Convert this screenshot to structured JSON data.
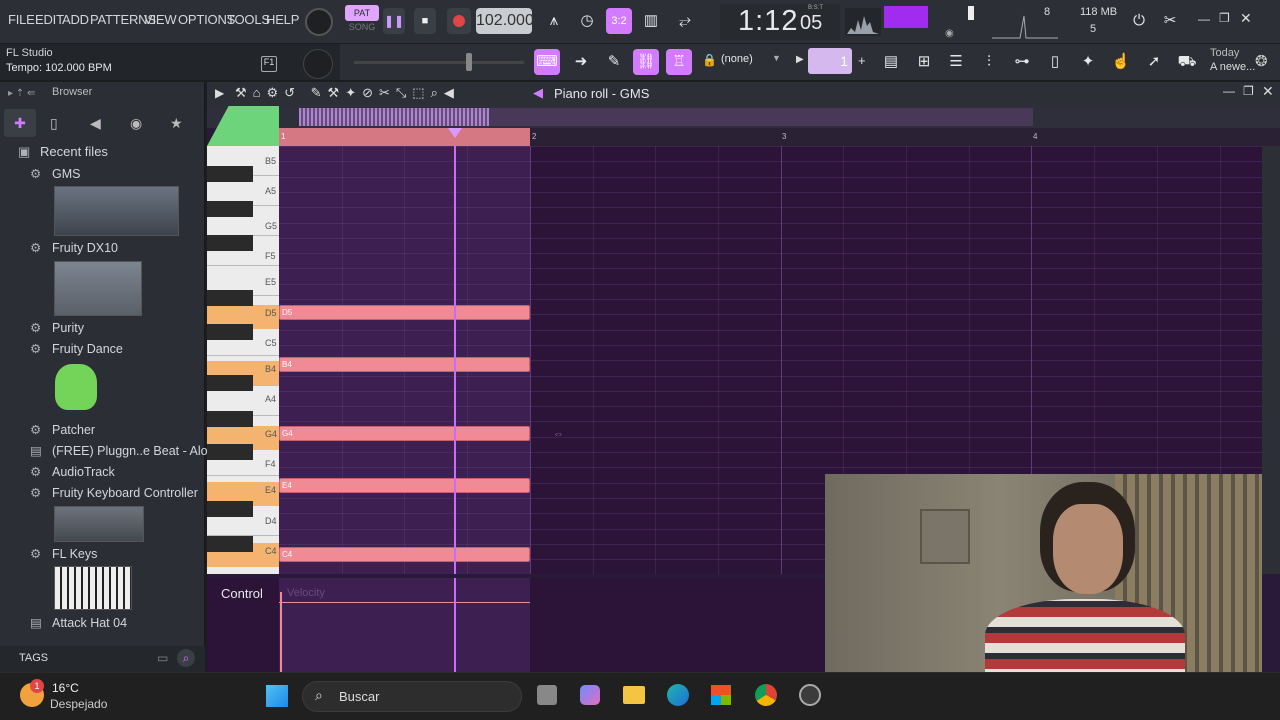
{
  "menu": {
    "file": "FILE",
    "edit": "EDIT",
    "add": "ADD",
    "patterns": "PATTERNS",
    "view": "VIEW",
    "options": "OPTIONS",
    "tools": "TOOLS",
    "help": "HELP"
  },
  "transport": {
    "pat": "PAT",
    "song": "SONG",
    "tempo": "102.000",
    "time": "1:12",
    "time_frac": "05",
    "bst": "B:S:T"
  },
  "stats": {
    "cpu": "8",
    "mem": "118 MB",
    "poly": "5"
  },
  "hint": {
    "app": "FL Studio",
    "tempo": "Tempo: 102.000 BPM"
  },
  "toolbar2": {
    "pattern_name": "(none)",
    "pattern_num": "1",
    "news_date": "Today",
    "news_text": "A newe..."
  },
  "browser": {
    "title": "Browser",
    "items": [
      {
        "label": "Recent files"
      },
      {
        "label": "GMS"
      },
      {
        "label": "Fruity DX10"
      },
      {
        "label": "Purity"
      },
      {
        "label": "Fruity Dance"
      },
      {
        "label": "Patcher"
      },
      {
        "label": "(FREE) Pluggn..e Beat - Alone"
      },
      {
        "label": "AudioTrack"
      },
      {
        "label": "Fruity Keyboard Controller"
      },
      {
        "label": "FL Keys"
      },
      {
        "label": "Attack Hat 04"
      }
    ],
    "tags": "TAGS"
  },
  "pianoroll": {
    "title": "Piano roll - GMS",
    "bars": [
      "1",
      "2",
      "3",
      "4"
    ],
    "keys": [
      "B5",
      "A5",
      "G5",
      "F5",
      "E5",
      "D5",
      "C5",
      "B4",
      "A4",
      "G4",
      "F4",
      "E4",
      "D4",
      "C4"
    ],
    "notes": [
      {
        "name": "D5",
        "label": "D5"
      },
      {
        "name": "B4",
        "label": "B4"
      },
      {
        "name": "G4",
        "label": "G4"
      },
      {
        "name": "E4",
        "label": "E4"
      },
      {
        "name": "C4",
        "label": "C4"
      }
    ],
    "control_label": "Control",
    "velocity_label": "Velocity"
  },
  "taskbar": {
    "temp": "16°C",
    "weather": "Despejado",
    "search_placeholder": "Buscar",
    "weather_badge": "1"
  },
  "colors": {
    "accent": "#d37bff",
    "note": "#f08a94",
    "grid": "#2b1438",
    "toolbar": "#2c3036"
  }
}
